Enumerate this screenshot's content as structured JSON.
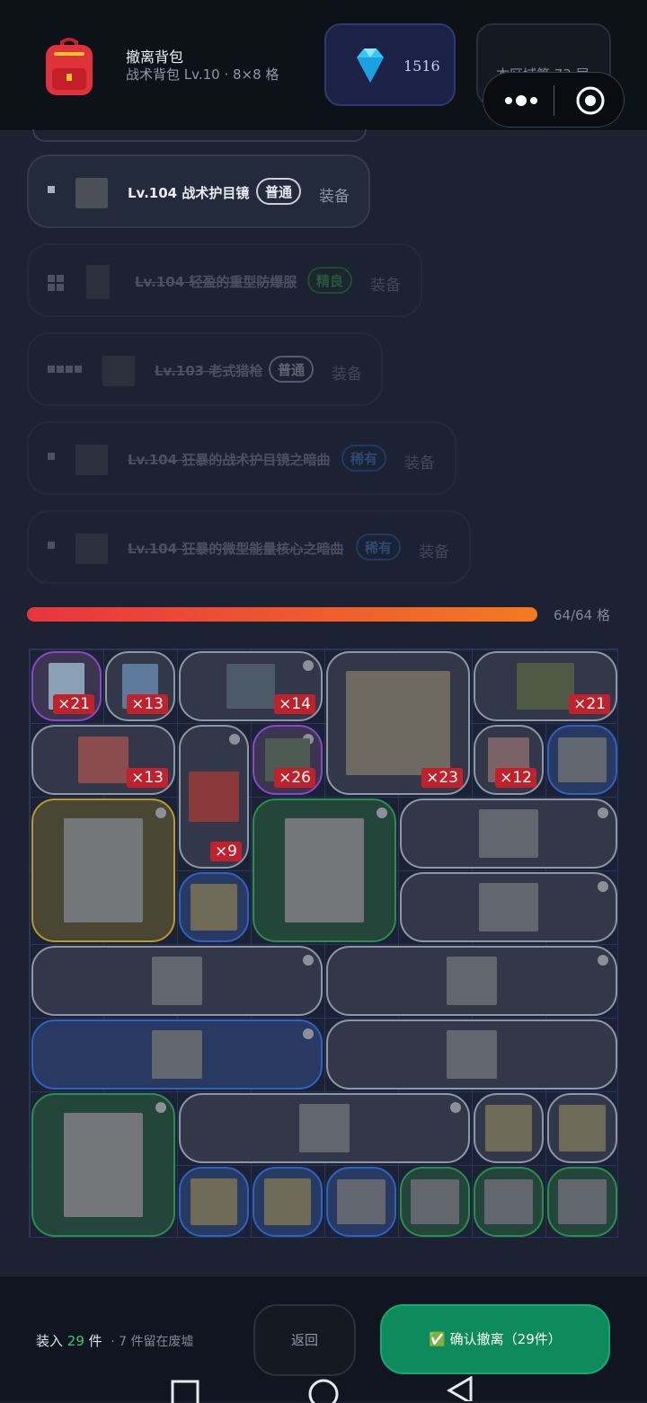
{
  "header": {
    "title": "撤离背包",
    "subtitle": "战术背包 Lv.10 · 8×8 格",
    "gems": "1516",
    "zone": "本区域第 73 层"
  },
  "equipment_list": [
    {
      "name": "Lv.104 战术护目镜",
      "rarity": "普通",
      "action": "装备",
      "enabled": true
    },
    {
      "name": "Lv.104 轻盈的重型防爆服",
      "rarity": "精良",
      "action": "装备",
      "enabled": false
    },
    {
      "name": "Lv.103 老式猎枪",
      "rarity": "普通",
      "action": "装备",
      "enabled": false
    },
    {
      "name": "Lv.104 狂暴的战术护目镜之暗曲",
      "rarity": "稀有",
      "action": "装备",
      "enabled": false
    },
    {
      "name": "Lv.104 狂暴的微型能量核心之暗曲",
      "rarity": "稀有",
      "action": "装备",
      "enabled": false
    }
  ],
  "capacity": {
    "used": 64,
    "total": 64,
    "fraction": 1.0,
    "text": "64/64 格"
  },
  "backpack_items": [
    {
      "name": "glass-plate",
      "qty": "×21",
      "rarity": "purple"
    },
    {
      "name": "potion-bottle",
      "qty": "×13",
      "rarity": "gray"
    },
    {
      "name": "toolbox",
      "qty": "×14",
      "rarity": "gray"
    },
    {
      "name": "first-aid-case",
      "qty": "×23",
      "rarity": "gray"
    },
    {
      "name": "ammo-box",
      "qty": "×21",
      "rarity": "gray"
    },
    {
      "name": "medkit",
      "qty": "×13",
      "rarity": "gray"
    },
    {
      "name": "fuel-can",
      "qty": "×9",
      "rarity": "gray"
    },
    {
      "name": "parts-box",
      "qty": "×26",
      "rarity": "purple"
    },
    {
      "name": "red-potion",
      "qty": "×12",
      "rarity": "gray"
    },
    {
      "name": "goggles",
      "qty": "",
      "rarity": "blue"
    },
    {
      "name": "bomb-suit",
      "qty": "",
      "rarity": "gold"
    },
    {
      "name": "bomb-suit",
      "qty": "",
      "rarity": "green"
    },
    {
      "name": "assault-rifle",
      "qty": "",
      "rarity": "gray"
    },
    {
      "name": "energy-core",
      "qty": "",
      "rarity": "blue"
    },
    {
      "name": "assault-rifle",
      "qty": "",
      "rarity": "gray"
    },
    {
      "name": "hunting-rifle",
      "qty": "",
      "rarity": "gray"
    },
    {
      "name": "hunting-rifle",
      "qty": "",
      "rarity": "gray"
    },
    {
      "name": "hunting-rifle",
      "qty": "",
      "rarity": "blue"
    },
    {
      "name": "hunting-rifle",
      "qty": "",
      "rarity": "gray"
    },
    {
      "name": "bomb-suit",
      "qty": "",
      "rarity": "green"
    },
    {
      "name": "hunting-rifle",
      "qty": "",
      "rarity": "gray"
    },
    {
      "name": "energy-core",
      "qty": "",
      "rarity": "gray"
    },
    {
      "name": "energy-core",
      "qty": "",
      "rarity": "gray"
    },
    {
      "name": "energy-core",
      "qty": "",
      "rarity": "blue"
    },
    {
      "name": "energy-core",
      "qty": "",
      "rarity": "blue"
    },
    {
      "name": "goggles",
      "qty": "",
      "rarity": "blue"
    },
    {
      "name": "goggles",
      "qty": "",
      "rarity": "green"
    },
    {
      "name": "goggles",
      "qty": "",
      "rarity": "green"
    },
    {
      "name": "goggles",
      "qty": "",
      "rarity": "green"
    }
  ],
  "footer": {
    "load_prefix": "装入",
    "load_count": "29",
    "load_suffix": "件",
    "left_behind": "· 7 件留在废墟",
    "back": "返回",
    "confirm": "✅ 确认撤离（29件）"
  },
  "colors": {
    "accent_green": "#0d8b5d",
    "progress_start": "#e8343e",
    "progress_end": "#f27a22",
    "rare_blue": "#2d62c4",
    "fine_green": "#2a8e4e",
    "epic_purple": "#8a47cc",
    "legend_gold": "#b79a2c"
  }
}
